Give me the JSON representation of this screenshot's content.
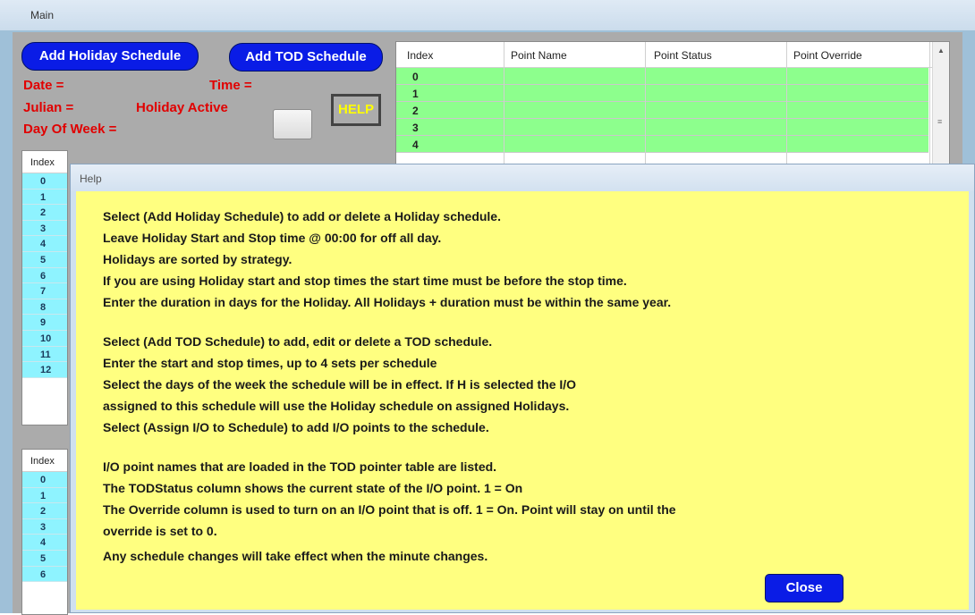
{
  "main_window": {
    "title": "Main",
    "add_holiday_label": "Add Holiday Schedule",
    "add_tod_label": "Add TOD Schedule",
    "date_label": "Date =",
    "time_label": "Time =",
    "julian_label": "Julian =",
    "holiday_active_label": "Holiday Active",
    "day_of_week_label": "Day Of Week =",
    "help_label": "HELP"
  },
  "point_grid": {
    "columns": [
      "Index",
      "Point Name",
      "Point Status",
      "Point Override"
    ],
    "rows": [
      "0",
      "1",
      "2",
      "3",
      "4"
    ]
  },
  "holiday_list": {
    "header": "Index",
    "rows": [
      "0",
      "1",
      "2",
      "3",
      "4",
      "5",
      "6",
      "7",
      "8",
      "9",
      "10",
      "11",
      "12"
    ]
  },
  "tod_list": {
    "header": "Index",
    "rows": [
      "0",
      "1",
      "2",
      "3",
      "4",
      "5",
      "6"
    ]
  },
  "help_dialog": {
    "title": "Help",
    "lines": [
      "Select (Add Holiday Schedule) to add or delete a Holiday schedule.",
      "Leave Holiday Start and Stop time @ 00:00 for off all day.",
      "Holidays are sorted by strategy.",
      "If you are using Holiday start and stop times the start time must be before the stop time.",
      "Enter the duration in days for the Holiday. All Holidays + duration must be within the same year.",
      "Select (Add TOD Schedule) to add, edit or delete a TOD schedule.",
      "Enter the start and stop times, up to 4 sets per schedule",
      "Select the days of the week the schedule will be in effect.  If H is selected the I/O",
      "assigned to this schedule will use the Holiday schedule on assigned Holidays.",
      "Select (Assign I/O to Schedule) to add I/O points to the schedule.",
      "I/O point names that are loaded in the TOD pointer table are listed.",
      "The TODStatus column shows the current state of the I/O point.  1 = On",
      "The Override column is used to turn on an I/O point that is off.  1 = On.  Point will stay on until the",
      "override is set to 0.",
      "Any schedule changes will take effect when the minute changes."
    ],
    "close_label": "Close"
  },
  "colors": {
    "button_blue": "#0a1ce6",
    "label_red": "#e10000",
    "help_yellow": "#ffff80",
    "grid_green": "#8dff8d",
    "list_cyan": "#8ef3ff"
  }
}
